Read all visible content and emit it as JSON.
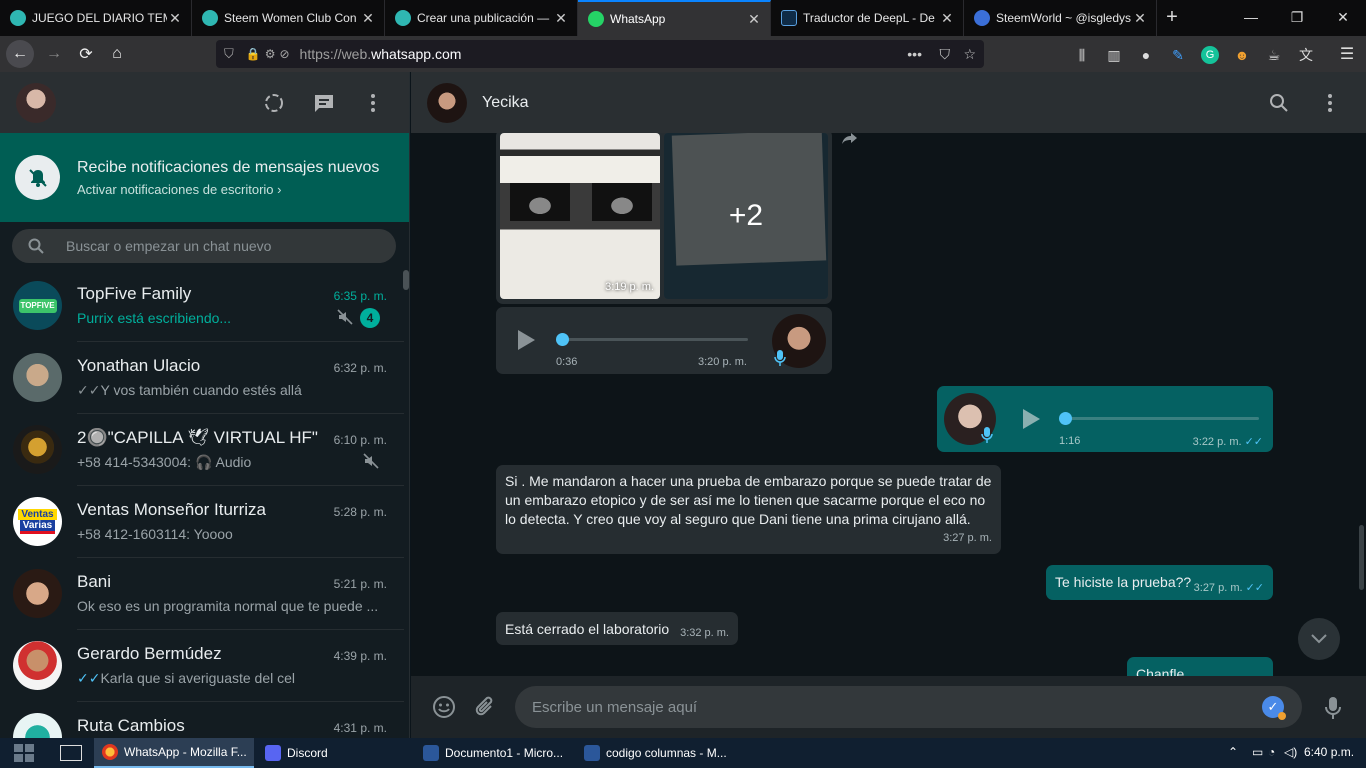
{
  "browser": {
    "tabs": [
      {
        "title": "JUEGO DEL DIARIO TEMP",
        "color": "#2fb7b2"
      },
      {
        "title": "Steem Women Club Con",
        "color": "#2fb7b2"
      },
      {
        "title": "Crear una publicación —",
        "color": "#2fb7b2"
      },
      {
        "title": "WhatsApp",
        "color": "#25d366"
      },
      {
        "title": "Traductor de DeepL - De",
        "color": "#0f2b46"
      },
      {
        "title": "SteemWorld ~ @isgledys",
        "color": "#3b6fd8"
      }
    ],
    "url_prefix": "https://web.",
    "url_domain": "whatsapp.com"
  },
  "notification": {
    "title": "Recibe notificaciones de mensajes nuevos",
    "subtitle": "Activar notificaciones de escritorio"
  },
  "search": {
    "placeholder": "Buscar o empezar un chat nuevo"
  },
  "chats": [
    {
      "name": "TopFive Family",
      "time": "6:35 p. m.",
      "last": "Purrix está escribiendo...",
      "badge": "4"
    },
    {
      "name": "Yonathan Ulacio",
      "time": "6:32 p. m.",
      "last": "Y vos también cuando estés allá"
    },
    {
      "name": "2🔘\"CAPILLA 🕊 VIRTUAL  HF\"",
      "time": "6:10 p. m.",
      "last": "+58 414-5343004: 🎧 Audio"
    },
    {
      "name": "Ventas Monseñor Iturriza",
      "time": "5:28 p. m.",
      "last": "+58 412-1603114: Yoooo"
    },
    {
      "name": "Bani",
      "time": "5:21 p. m.",
      "last": "Ok eso es un programita normal que te puede ..."
    },
    {
      "name": "Gerardo Bermúdez",
      "time": "4:39 p. m.",
      "last": "Karla que si averiguaste del cel"
    },
    {
      "name": "Ruta Cambios",
      "time": "4:31 p. m.",
      "last": ""
    }
  ],
  "conversation": {
    "contact_name": "Yecika",
    "photo_time": "3:19 p. m.",
    "photo_more": "+2",
    "audio_in": {
      "duration": "0:36",
      "time": "3:20 p. m."
    },
    "audio_out": {
      "duration": "1:16",
      "time": "3:22 p. m."
    },
    "messages": [
      {
        "text": "Si . Me mandaron a hacer una prueba de embarazo porque se puede tratar de un embarazo etopico y de ser así me lo tienen que sacarme porque el eco no lo detecta. Y creo que voy al seguro que Dani tiene una prima cirujano allá.",
        "time": "3:27 p. m."
      },
      {
        "text": "Te hiciste la prueba??",
        "time": "3:27 p. m."
      },
      {
        "text": "Está cerrado el laboratorio",
        "time": "3:32 p. m."
      },
      {
        "text": "Chanfle",
        "time": ""
      }
    ],
    "composer_placeholder": "Escribe un mensaje aquí"
  },
  "taskbar": {
    "items": [
      "WhatsApp - Mozilla F...",
      "Discord",
      "Documento1 - Micro...",
      "codigo columnas - M..."
    ],
    "clock": "6:40 p.m."
  }
}
